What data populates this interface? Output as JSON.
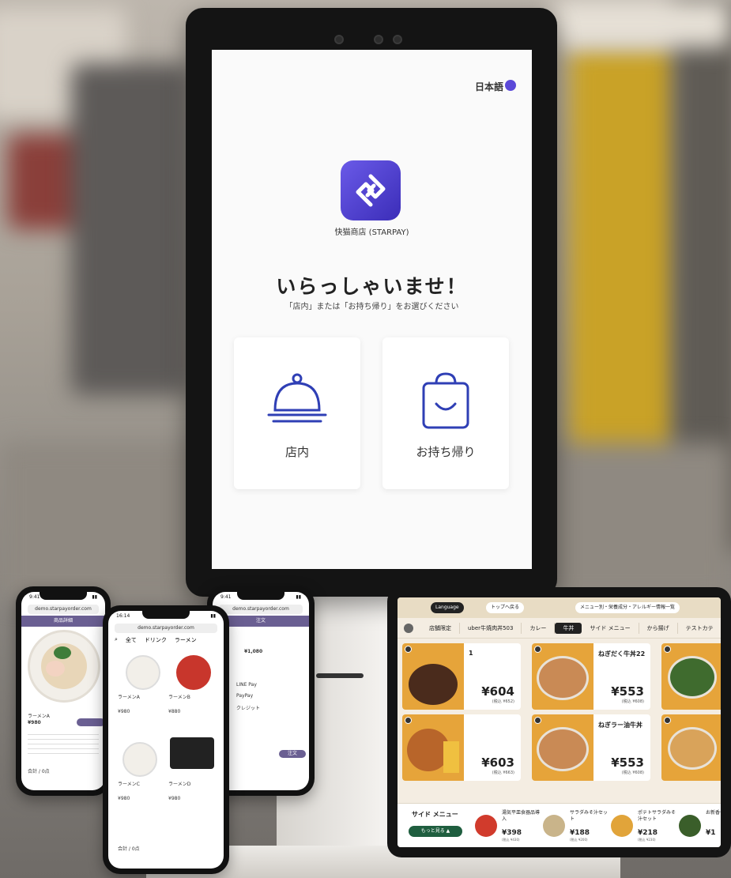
{
  "kiosk": {
    "lang_label": "日本語",
    "store_name": "快猫商店 (STARPAY)",
    "welcome": "いらっしゃいませ！",
    "instruction": "「店内」または「お持ち帰り」をお選びください",
    "dine_in": "店内",
    "takeout": "お持ち帰り"
  },
  "phone_left": {
    "time": "9:41",
    "url": "demo.starpayorder.com",
    "header": "商品詳細",
    "item_name": "ラーメンA",
    "price": "¥980",
    "cart": "合計 / 0点"
  },
  "phone_center": {
    "time": "16:14",
    "url": "demo.starpayorder.com",
    "tabs": [
      "全て",
      "ドリンク",
      "ラーメン"
    ],
    "items": [
      {
        "name": "ラーメンA",
        "price": "¥980"
      },
      {
        "name": "ラーメンB",
        "price": "¥880"
      },
      {
        "name": "ラーメンC",
        "price": "¥980"
      },
      {
        "name": "ラーメンD",
        "price": "¥980"
      }
    ],
    "cart": "合計 / 0点"
  },
  "phone_right": {
    "time": "9:41",
    "url": "demo.starpayorder.com",
    "header": "注文",
    "price": "¥1,080",
    "pay_options": [
      "LINE Pay",
      "PayPay",
      "クレジット"
    ],
    "button": "注文"
  },
  "tablet": {
    "language_btn": "Language",
    "top_btn": "トップへ戻る",
    "menu_link": "メニュー別・栄養成分・アレルギー情報一覧",
    "categories": [
      "店舗限定",
      "uber牛焼肉丼503",
      "カレー",
      "牛丼",
      "サイド メニュー",
      "から揚げ",
      "テストカテ"
    ],
    "active_category": "牛丼",
    "cards": [
      {
        "name": "1",
        "price": "¥604",
        "tax": "(税込 ¥652)"
      },
      {
        "name": "ねぎだく牛丼22",
        "price": "¥553",
        "tax": "(税込 ¥608)"
      },
      {
        "name": "",
        "price": "¥603",
        "tax": "(税込 ¥663)"
      },
      {
        "name": "ねぎラー油牛丼",
        "price": "¥553",
        "tax": "(税込 ¥608)"
      }
    ],
    "side_menu_title": "サイド メニュー",
    "more_btn": "もっと見る ▲",
    "side_items": [
      {
        "name": "湯気平皿食器品導入",
        "price": "¥398",
        "tax": "(税込 ¥430)"
      },
      {
        "name": "サラダみそ汁セット",
        "price": "¥188",
        "tax": "(税込 ¥200)"
      },
      {
        "name": "ポテトサラダみそ汁セット",
        "price": "¥218",
        "tax": "(税込 ¥230)"
      },
      {
        "name": "お新香セット",
        "price": "¥1",
        "tax": ""
      }
    ]
  },
  "colors": {
    "brand_purple": "#5b49d8",
    "kiosk_outline": "#2f3fb5",
    "tablet_bg": "#f4ede2",
    "food_orange": "#e6a43a",
    "phone_header": "#6a5f92",
    "green_button": "#1f5e3f"
  }
}
